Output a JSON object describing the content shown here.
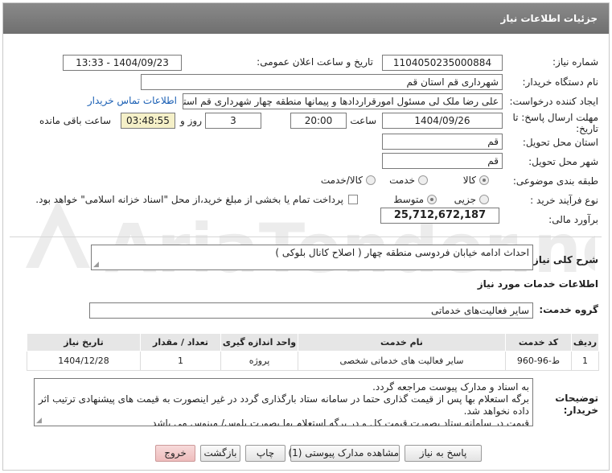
{
  "header": {
    "title": "جزئیات اطلاعات نیاز"
  },
  "form": {
    "need_number_label": "شماره نیاز:",
    "need_number": "1104050235000884",
    "announce_label": "تاریخ و ساعت اعلان عمومی:",
    "announce_value": "1404/09/23 - 13:33",
    "buyer_org_label": "نام دستگاه خریدار:",
    "buyer_org": "شهرداری قم استان قم",
    "requester_label": "ایجاد کننده درخواست:",
    "requester": "علی رضا ملک لی مسئول امورقراردادها و پیمانها منطقه چهار  شهرداری قم استان قم",
    "contact_link": "اطلاعات تماس خریدار",
    "deadline_label_1": "مهلت ارسال پاسخ: تا",
    "deadline_label_2": "تاریخ:",
    "deadline_date": "1404/09/26",
    "time_label": "ساعت",
    "deadline_time": "20:00",
    "days_value": "3",
    "days_label": "روز و",
    "remaining_time": "03:48:55",
    "remaining_label": "ساعت باقی مانده",
    "province_label": "استان محل تحویل:",
    "province": "قم",
    "city_label": "شهر محل تحویل:",
    "city": "قم",
    "category_label": "طبقه بندی موضوعی:",
    "category_options": [
      "کالا",
      "خدمت",
      "کالا/خدمت"
    ],
    "category_selected": "خدمت",
    "process_label": "نوع فرآیند خرید :",
    "process_options": [
      "جزیی",
      "متوسط"
    ],
    "process_selected": "متوسط",
    "payment_note": "پرداخت تمام یا بخشی از مبلغ خرید،از محل \"اسناد خزانه اسلامی\" خواهد بود.",
    "estimate_label": "برآورد مالی:",
    "estimate": "25,712,672,187"
  },
  "description": {
    "label": "شرح کلی نیاز:",
    "text": "احداث ادامه خیابان فردوسی منطقه چهار ( اصلاح کانال بلوکی )"
  },
  "services": {
    "section_title": "اطلاعات خدمات مورد نیاز",
    "group_label": "گروه خدمت:",
    "group_value": "سایر فعالیت‌های خدماتی"
  },
  "table": {
    "headers": [
      "ردیف",
      "کد خدمت",
      "نام خدمت",
      "واحد اندازه گیری",
      "تعداد / مقدار",
      "تاریخ نیاز"
    ],
    "rows": [
      [
        "1",
        "ط-96-960",
        "سایر فعالیت های خدماتی شخصی",
        "پروژه",
        "1",
        "1404/12/28"
      ]
    ]
  },
  "buyer_notes": {
    "label_1": "توضیحات",
    "label_2": "خریدار:",
    "lines": [
      "به اسناد و مدارک پیوست مراجعه گردد.",
      "برگه استعلام بها  پس از قیمت گذاری حتما در سامانه ستاد بارگذاری گردد در غیر اینصورت به قیمت های پیشنهادی ترتیب اثر داده نخواهد شد.",
      "قیمت در سامانه ستاد بصورت قیمت کل و در برگه استعلام بها بصورت پلوس/ مینوس می باشد"
    ]
  },
  "buttons": {
    "reply": "پاسخ به نیاز",
    "attachments": "مشاهده مدارک پیوستی (1)",
    "print": "چاپ",
    "back": "بازگشت",
    "exit": "خروج"
  },
  "watermark": {
    "text": "AriaTender.neT"
  }
}
